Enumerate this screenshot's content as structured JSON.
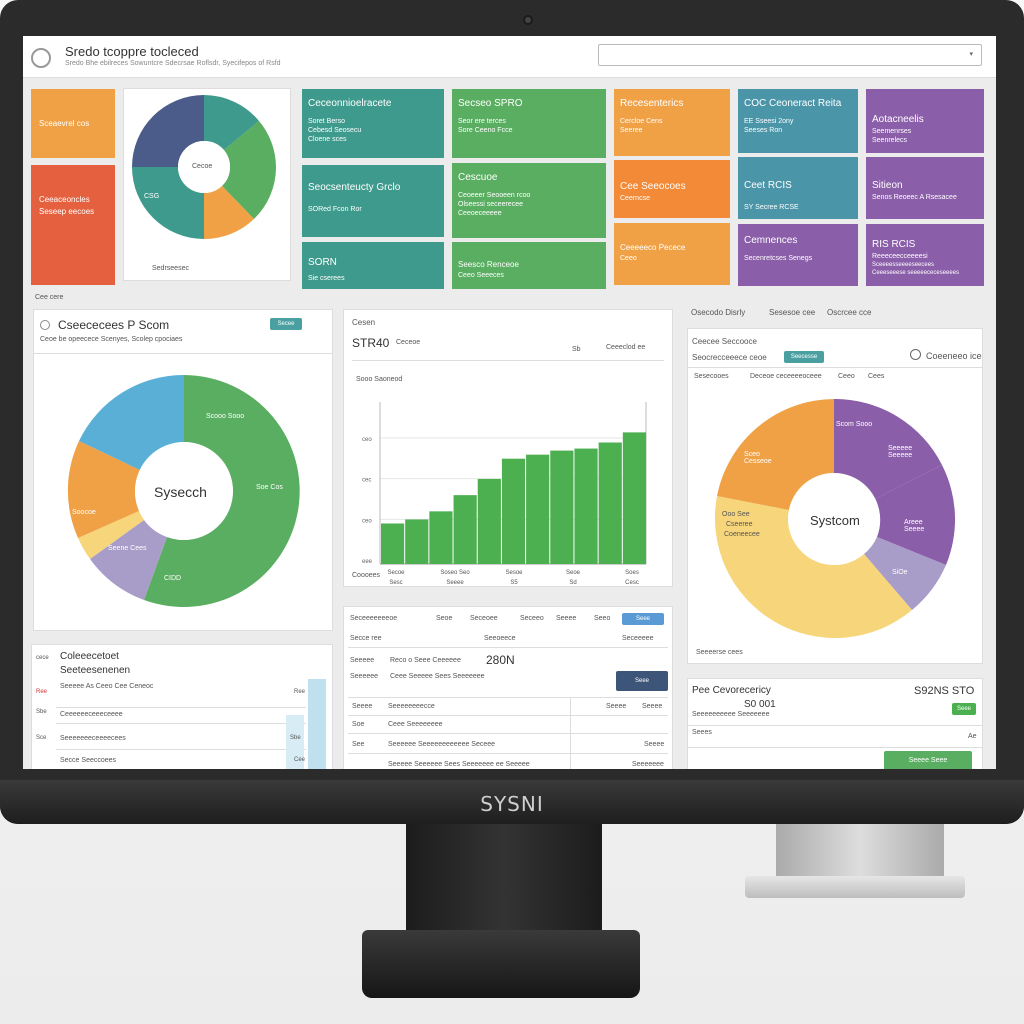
{
  "brand": "SYSNI",
  "header": {
    "title": "Sredo tcoppre tocleced",
    "subtitle": "Sredo Bhe ebilreces Sowuntcre Sdecrsae Roflsdr, Syecifepos of Rsfd",
    "search_placeholder": "",
    "search_caret": "▾"
  },
  "left_tiles": {
    "orange": "Sceaevrel cos",
    "red_line1": "Ceeaceoncles",
    "red_line2": "Seseep eecoes"
  },
  "top_donut": {
    "center_label": "Cecoe",
    "side_label": "CSG",
    "caption": "Sedrseesec"
  },
  "tiles": [
    {
      "l1": "Ceceonnioelracete",
      "l2": "Soret Berso",
      "l3": "Cebesd Seosecu",
      "l4": "Cloene sces"
    },
    {
      "l1": "Secseo SPRO",
      "l2": "Seor ere terces",
      "l3": "Sore Ceeno Fcce"
    },
    {
      "l1": "Recesenterics",
      "l2": "Cercloe Cens",
      "l3": "Seeree"
    },
    {
      "l1": "COC Ceoneract Reita",
      "l2": "EE Sseesi 2ony",
      "l3": "Seeses Ron"
    },
    {
      "l1": "Aotacneelis",
      "l2": "Seemenrses",
      "l3": "Seenrelecs"
    },
    {
      "l1": "Seocsenteucty Grclo",
      "l2": "SORed Fcon Ror"
    },
    {
      "l1": "Cescuoe",
      "l2": "Ceoeeer Seooeen rcoo",
      "l3": "Olseessi seceerecee",
      "l4": "Ceeoeceeeee"
    },
    {
      "l1": "Cee Seeocoes",
      "l2": "Ceerncse"
    },
    {
      "l1": "Ceet RCIS",
      "l2": "SY Secree RCSE"
    },
    {
      "l1": "Sitieon",
      "l2": "Senos Reoeec A Rsesacee"
    },
    {
      "l1": "SORN",
      "l2": "Sie cserees"
    },
    {
      "l1": "Seesco Renceoe",
      "l2": "Ceeo Seeeces"
    },
    {
      "l1": "Ceeeeeco Pecece",
      "l2": "Ceeo"
    },
    {
      "l1": "Cemnences",
      "l2": "Secenretcses Senegs"
    },
    {
      "l1": "RIS RCIS",
      "l2": "Reeeceecceeeesi",
      "l3": "Sceeeesseeeeseecees",
      "l4": "Ceeeseeese seeeeececeseeees"
    }
  ],
  "section_label": "Cee cere",
  "panel_left": {
    "title": "Cseececees P Scom",
    "subtitle": "Ceoe be opeecece Scenyes, Scolep cpociaes",
    "button": "Secee",
    "center_label": "Sysecch",
    "labels": [
      "Scooo Sooo",
      "Soocoe",
      "Soe Cos",
      "Seene Cees",
      "CIDD"
    ]
  },
  "panel_mid": {
    "heading": "Cesen",
    "value": "STR40",
    "value_suffix": "Ceceoe",
    "right_a": "Sb",
    "right_b": "Ceeeclod ee",
    "axis_caption": "Sooo Saoneod",
    "footer": "Coooees",
    "chart_data": {
      "type": "area",
      "x": [
        "1",
        "2",
        "3",
        "4",
        "5",
        "6",
        "7",
        "8",
        "9",
        "10",
        "11"
      ],
      "values": [
        20,
        22,
        26,
        34,
        42,
        52,
        54,
        56,
        57,
        60,
        65
      ],
      "yticks": [
        "ceo",
        "cec",
        "ceo",
        "eee"
      ],
      "xlabels": [
        "Secoe",
        "Soseo Seo",
        "Sesoe",
        "Seoe",
        "Soes"
      ],
      "xsublabels": [
        "Sesc",
        "Seeee",
        "S5",
        "Sd",
        "Cesc"
      ]
    }
  },
  "panel_right": {
    "tabs": [
      "Osecodo Disrly",
      "Sesesoe cee",
      "Oscrcee cce"
    ],
    "title": "Ceecee Seccooce",
    "subtitle": "Seocrecceeece ceoe",
    "badge": "Seecesse",
    "right_link": "Coeeneeo ice",
    "cols": [
      "Sesecooes",
      "Deceoe ceceeeeoceee",
      "Ceeo",
      "Cees"
    ],
    "center_label": "Systcom",
    "labels": [
      "Scom Sooo",
      "Seeeee Seeeee",
      "Areee Seeee",
      "SiOe",
      "Sceo Cesseoe",
      "Ooo See",
      "Cseeree",
      "Coeneecee"
    ],
    "footer": "Seeeerse cees"
  },
  "panel_bl": {
    "title": "Coleeecetoet",
    "subtitle": "Seeteesenenen",
    "desc": "Seeeee As Ceeo Cee Ceneoc",
    "rows": [
      "Ceeeeeeceeeceeee",
      "Seeeeeeeceeeecees",
      "Secce Seeccoees"
    ],
    "values": [
      "Ree",
      "Sbe",
      "Cee"
    ],
    "left_tags": [
      "cece",
      "Ree",
      "Sbe",
      "Sce"
    ]
  },
  "panel_bm": {
    "tabs": [
      "Seceeeeeeeoe",
      "Seoe",
      "Seceoee",
      "Seceeo",
      "Seeee",
      "Seeo"
    ],
    "active_tab": "Seee",
    "col_a": "Secce ree",
    "col_b": "Seeoeece",
    "col_c": "Seceeeee",
    "row1_label": "Seeeee",
    "row1_value": "Reco o Seee Ceeeeee",
    "row1_amount": "280N",
    "row2_label": "Seeeeee",
    "row2_text": "Ceee Seeeee Sees Seeeeeee",
    "button": "Seee",
    "rows": [
      {
        "a": "Seeee",
        "b": "Seeeeeeeecce",
        "c": "Seeee",
        "d": "Seeee"
      },
      {
        "a": "Soe",
        "b": "Ceee Seeeeeeee",
        "c": "",
        "d": ""
      },
      {
        "a": "See",
        "b": "Seeeeee Seeeeeeeeeeee Seceee",
        "c": "",
        "d": "Seeee"
      },
      {
        "a": "",
        "b": "Seeeee Seeeeee Sees Seeeeeee ee Seeeee",
        "c": "",
        "d": "Seeeeeee"
      }
    ]
  },
  "panel_br": {
    "title": "Pee Cevorecericy",
    "value": "S92NS STO",
    "sub_value": "S0 001",
    "sub_text": "Seeeeeeeeee Seeeeeee",
    "badge": "Seee",
    "row_label": "Seees",
    "row_value": "Ae",
    "button": "Seeee Seee"
  },
  "colors": {
    "orange": "#f0a145",
    "red": "#e4603f",
    "teal": "#3e9a8c",
    "green": "#5aae61",
    "blue_teal": "#4a95a8",
    "purple": "#8a5ea8",
    "slate": "#4b5c8a",
    "sky": "#5aafd6",
    "lavender": "#a89cc8",
    "light_yellow": "#f6d57b"
  }
}
